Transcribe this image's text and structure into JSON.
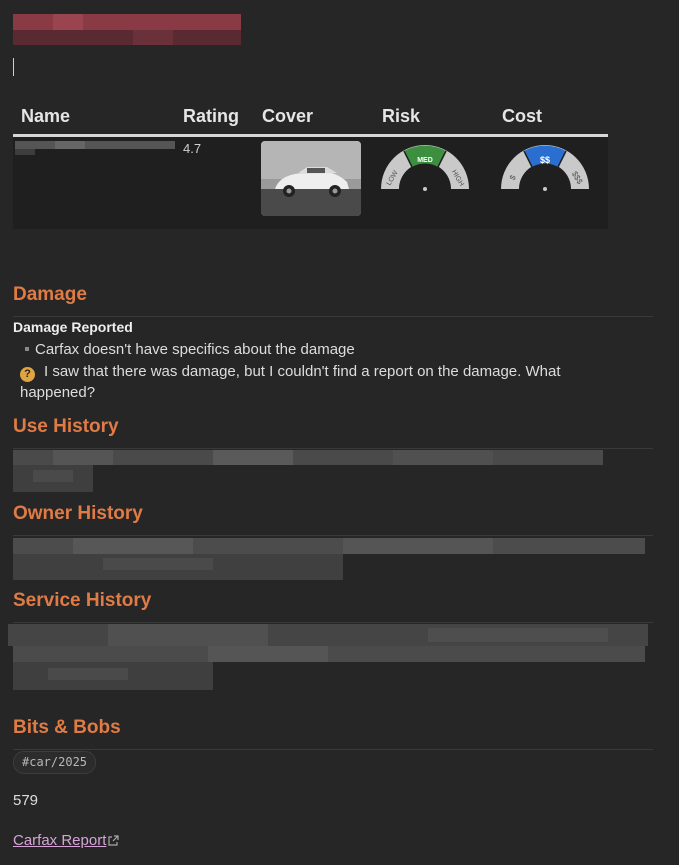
{
  "table": {
    "headers": [
      "Name",
      "Rating",
      "Cover",
      "Risk",
      "Cost"
    ],
    "rating": "4.7",
    "risk_gauge": {
      "labels": [
        "LOW",
        "MED",
        "HIGH"
      ],
      "selected": "MED",
      "color": "#3c8f3f"
    },
    "cost_gauge": {
      "labels": [
        "$",
        "$$",
        "$$$"
      ],
      "selected": "$$",
      "color": "#2a6fd0"
    }
  },
  "sections": {
    "damage": "Damage",
    "use_history": "Use History",
    "owner_history": "Owner History",
    "service_history": "Service History",
    "bits": "Bits & Bobs"
  },
  "damage": {
    "subheading": "Damage Reported",
    "bullet": "Carfax doesn't have specifics about the damage",
    "callout": "I saw that there was damage, but I couldn't find a report on the damage. What happened?",
    "callout_icon": "question-icon"
  },
  "bits": {
    "tag": "#car/2025",
    "number": "579",
    "link": "Carfax Report",
    "link_icon": "external-link-icon"
  },
  "colors": {
    "heading": "#e07b45",
    "link": "#d6a4d8",
    "background": "#262626"
  }
}
